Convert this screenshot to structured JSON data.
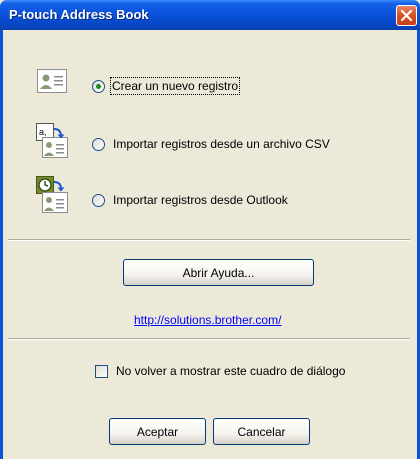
{
  "window": {
    "title": "P-touch Address Book"
  },
  "options": [
    {
      "label": "Crear un nuevo registro",
      "selected": true,
      "icon": "new-record-icon"
    },
    {
      "label": "Importar registros desde un archivo CSV",
      "selected": false,
      "icon": "csv-import-icon"
    },
    {
      "label": "Importar registros desde Outlook",
      "selected": false,
      "icon": "outlook-import-icon"
    }
  ],
  "help_button": "Abrir Ayuda...",
  "link": "http://solutions.brother.com/",
  "dont_show_checkbox": {
    "label": "No volver a mostrar este cuadro de diálogo",
    "checked": false
  },
  "ok_button": "Aceptar",
  "cancel_button": "Cancelar",
  "colors": {
    "accent": "#0A53DB",
    "close": "#D9501F",
    "link": "#0000FF"
  }
}
